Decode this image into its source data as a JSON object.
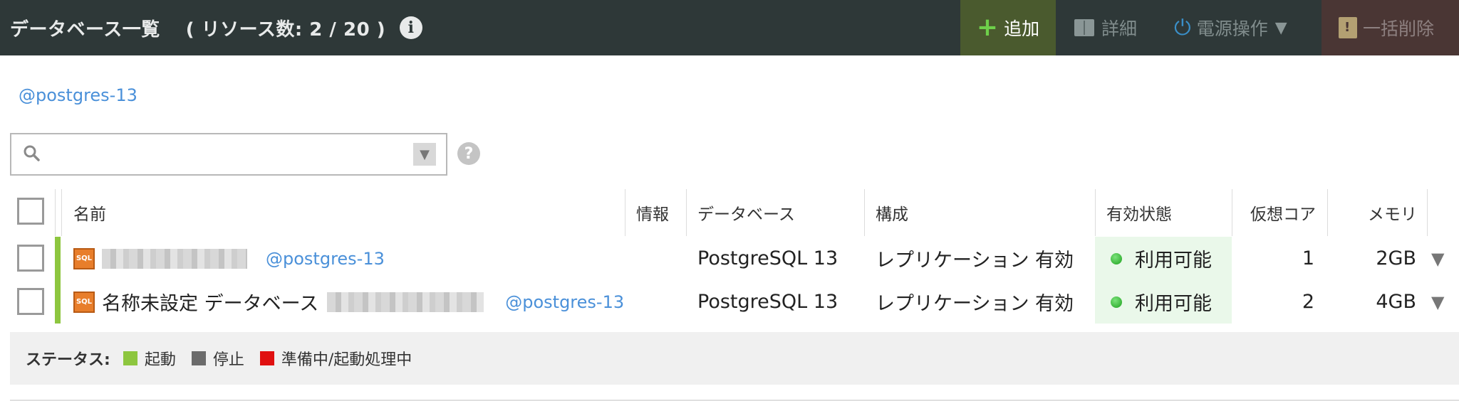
{
  "header": {
    "title": "データベース一覧",
    "resource_count": "( リソース数: 2 / 20 )",
    "info_icon": "i"
  },
  "toolbar": {
    "add_label": "追加",
    "detail_label": "詳細",
    "power_label": "電源操作",
    "bulk_delete_label": "一括削除"
  },
  "tag_filter": "@postgres-13",
  "search": {
    "value": "",
    "placeholder": "",
    "help_icon": "?"
  },
  "table": {
    "columns": {
      "name": "名前",
      "info": "情報",
      "database": "データベース",
      "config": "構成",
      "availability": "有効状態",
      "vcpu": "仮想コア",
      "memory": "メモリ"
    },
    "rows": [
      {
        "name": "",
        "tag": "@postgres-13",
        "database": "PostgreSQL 13",
        "config": "レプリケーション 有効",
        "availability": "利用可能",
        "vcpu": "1",
        "memory": "2GB",
        "status_color": "#8dc63f"
      },
      {
        "name": "名称未設定 データベース",
        "tag": "@postgres-13",
        "database": "PostgreSQL 13",
        "config": "レプリケーション 有効",
        "availability": "利用可能",
        "vcpu": "2",
        "memory": "4GB",
        "status_color": "#8dc63f"
      }
    ]
  },
  "legend": {
    "label": "ステータス:",
    "items": [
      {
        "label": "起動",
        "color": "#8dc63f"
      },
      {
        "label": "停止",
        "color": "#6b6b6b"
      },
      {
        "label": "準備中/起動処理中",
        "color": "#e01010"
      }
    ]
  },
  "icons": {
    "sql": "SQL"
  },
  "colors": {
    "header_bg": "#2e3838",
    "link": "#4a90d9",
    "available_bg": "#eaf8ea"
  }
}
